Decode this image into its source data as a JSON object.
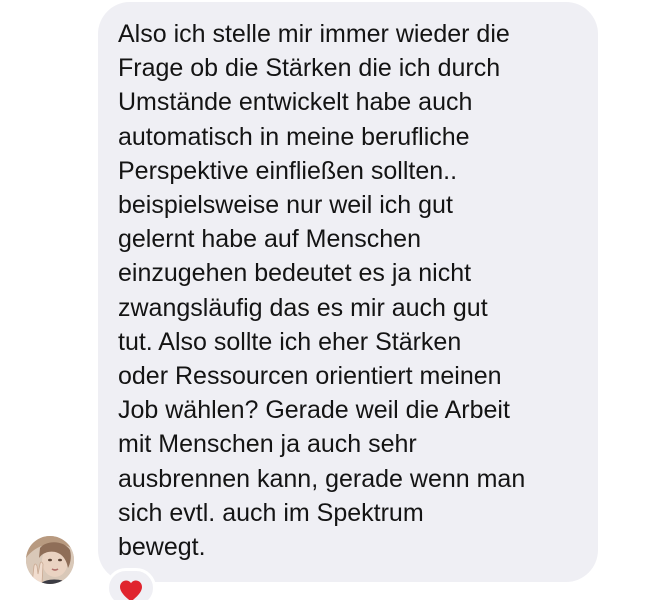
{
  "message": {
    "lines": [
      "Also ich stelle mir immer wieder die",
      "Frage ob die Stärken die ich durch",
      "Umstände entwickelt habe auch",
      "automatisch in meine berufliche",
      "Perspektive einfließen sollten..",
      "beispielsweise nur weil ich gut",
      "gelernt habe auf Menschen",
      "einzugehen bedeutet es ja nicht",
      "zwangsläufig das es mir auch gut",
      "tut. Also sollte ich eher Stärken",
      "oder Ressourcen orientiert meinen",
      "Job wählen? Gerade weil die Arbeit",
      "mit Menschen ja auch sehr",
      "ausbrennen kann, gerade wenn man",
      "sich evtl. auch im Spektrum",
      "bewegt."
    ],
    "bubble_color": "#efeff4",
    "text_color": "#141414"
  },
  "sender": {
    "avatar_icon": "profile-photo"
  },
  "reaction": {
    "icon": "heart-icon",
    "color": "#e0242e"
  }
}
